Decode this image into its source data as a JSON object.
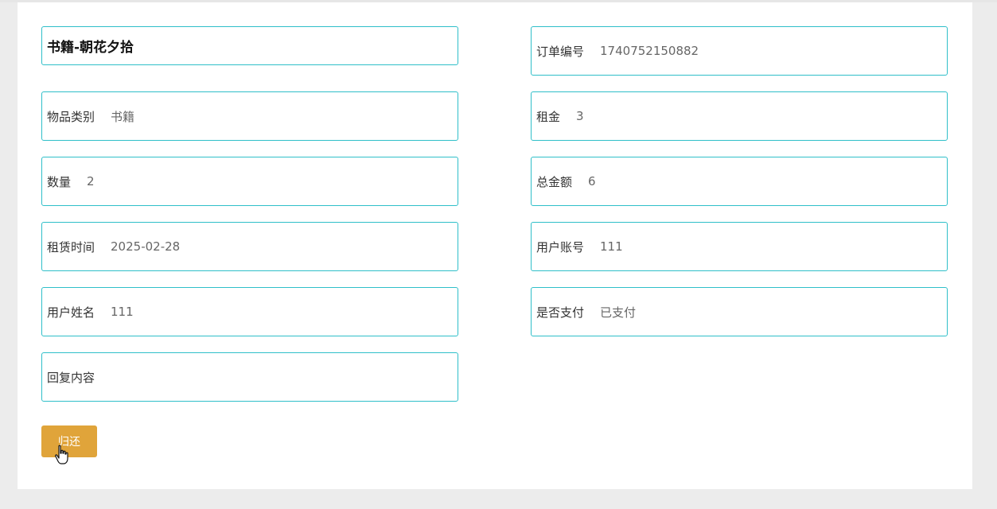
{
  "item": {
    "title": "书籍-朝花夕拾"
  },
  "left_fields": [
    {
      "label": "物品类别",
      "value": "书籍"
    },
    {
      "label": "数量",
      "value": "2"
    },
    {
      "label": "租赁时间",
      "value": "2025-02-28"
    },
    {
      "label": "用户姓名",
      "value": "111"
    },
    {
      "label": "回复内容",
      "value": ""
    }
  ],
  "right_fields": [
    {
      "label": "订单编号",
      "value": "1740752150882"
    },
    {
      "label": "租金",
      "value": "3"
    },
    {
      "label": "总金额",
      "value": "6"
    },
    {
      "label": "用户账号",
      "value": "111"
    },
    {
      "label": "是否支付",
      "value": "已支付"
    }
  ],
  "actions": {
    "return_label": "归还"
  },
  "colors": {
    "border": "#2fbfc9",
    "button": "#e0a43a",
    "background": "#ececec"
  },
  "icons": {
    "cursor": "hand-pointer-icon"
  }
}
